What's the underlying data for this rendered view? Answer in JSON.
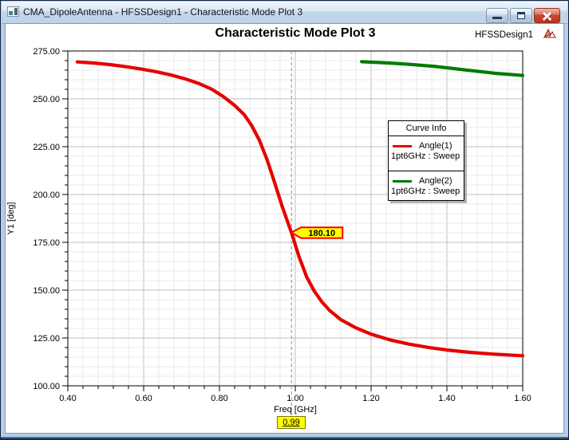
{
  "window": {
    "title": "CMA_DipoleAntenna - HFSSDesign1 - Characteristic Mode Plot 3"
  },
  "header": {
    "design_label": "HFSSDesign1"
  },
  "legend": {
    "header": "Curve Info"
  },
  "chart_data": {
    "type": "line",
    "title": "Characteristic Mode Plot 3",
    "xlabel": "Freq [GHz]",
    "ylabel": "Y1 [deg]",
    "xlim": [
      0.4,
      1.6
    ],
    "ylim": [
      100,
      275
    ],
    "x_minor_step": 0.04,
    "y_minor_step": 5,
    "x_tick_labels": [
      "0.40",
      "0.60",
      "0.80",
      "1.00",
      "1.20",
      "1.40",
      "1.60"
    ],
    "y_tick_labels": [
      "100.00",
      "125.00",
      "150.00",
      "175.00",
      "200.00",
      "225.00",
      "250.00",
      "275.00"
    ],
    "grid": true,
    "legend_position": "inside-upper-right",
    "series": [
      {
        "name": "Angle(1)",
        "detail": "1pt6GHz : Sweep",
        "color": "#e60000",
        "points": [
          [
            0.425,
            269.3
          ],
          [
            0.47,
            268.7
          ],
          [
            0.51,
            267.9
          ],
          [
            0.55,
            266.9
          ],
          [
            0.59,
            265.7
          ],
          [
            0.63,
            264.3
          ],
          [
            0.67,
            262.6
          ],
          [
            0.71,
            260.4
          ],
          [
            0.745,
            258.1
          ],
          [
            0.78,
            255.0
          ],
          [
            0.81,
            251.2
          ],
          [
            0.84,
            246.6
          ],
          [
            0.865,
            241.8
          ],
          [
            0.885,
            236.0
          ],
          [
            0.905,
            228.5
          ],
          [
            0.925,
            218.5
          ],
          [
            0.945,
            206.5
          ],
          [
            0.965,
            194.0
          ],
          [
            0.99,
            180.1
          ],
          [
            1.01,
            167.5
          ],
          [
            1.03,
            157.0
          ],
          [
            1.05,
            149.5
          ],
          [
            1.07,
            143.9
          ],
          [
            1.09,
            139.5
          ],
          [
            1.12,
            134.6
          ],
          [
            1.16,
            130.3
          ],
          [
            1.2,
            127.0
          ],
          [
            1.25,
            124.0
          ],
          [
            1.3,
            121.8
          ],
          [
            1.35,
            120.1
          ],
          [
            1.4,
            118.7
          ],
          [
            1.46,
            117.5
          ],
          [
            1.52,
            116.6
          ],
          [
            1.6,
            115.7
          ]
        ]
      },
      {
        "name": "Angle(2)",
        "detail": "1pt6GHz : Sweep",
        "color": "#007a00",
        "points": [
          [
            1.175,
            269.4
          ],
          [
            1.21,
            269.1
          ],
          [
            1.25,
            268.7
          ],
          [
            1.29,
            268.2
          ],
          [
            1.33,
            267.6
          ],
          [
            1.37,
            266.9
          ],
          [
            1.41,
            266.0
          ],
          [
            1.45,
            265.1
          ],
          [
            1.49,
            264.2
          ],
          [
            1.53,
            263.3
          ],
          [
            1.565,
            262.8
          ],
          [
            1.6,
            262.2
          ]
        ]
      }
    ],
    "marker": {
      "freq": 0.99,
      "x_label": "0.99",
      "value": 180.1,
      "value_label": "180.10"
    }
  }
}
